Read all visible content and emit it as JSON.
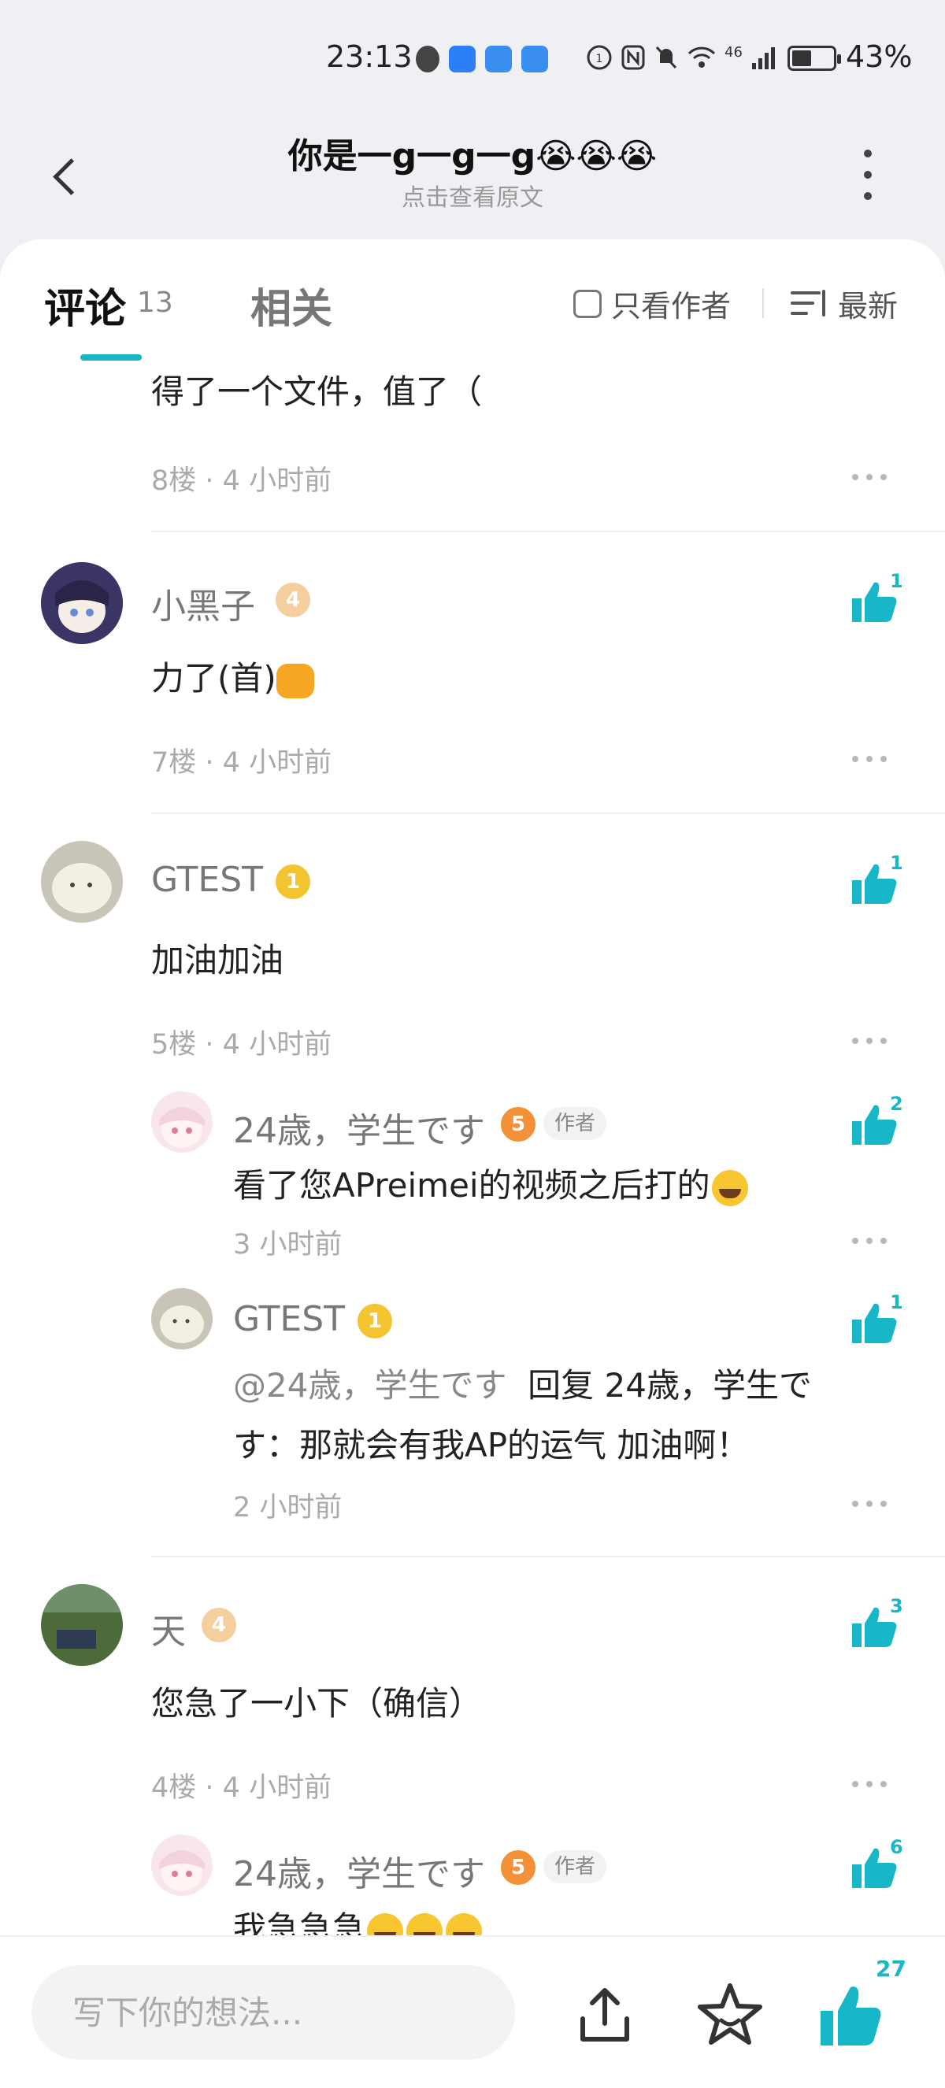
{
  "status_bar": {
    "time": "23:13",
    "net": "46",
    "battery": "43%"
  },
  "header": {
    "title": "你是一g一g一g😭😭😭",
    "subtitle": "点击查看原文"
  },
  "tabs": {
    "comments_label": "评论",
    "comments_count": "13",
    "related_label": "相关",
    "only_author": "只看作者",
    "sort": "最新"
  },
  "comments": [
    {
      "text": "得了一个文件，值了（",
      "floor": "8楼",
      "time": "4 小时前"
    },
    {
      "user": "小黑子",
      "level": "4",
      "text": "力了(首)",
      "floor": "7楼",
      "time": "4 小时前",
      "likes": "1"
    },
    {
      "user": "GTEST",
      "level": "1",
      "text": "加油加油",
      "floor": "5楼",
      "time": "4 小时前",
      "likes": "1",
      "replies": [
        {
          "user": "24歳，学生です",
          "level": "5",
          "tag": "作者",
          "text": "看了您APreimei的视频之后打的",
          "time": "3 小时前",
          "likes": "2"
        },
        {
          "user": "GTEST",
          "level": "1",
          "mention": "@24歳，学生です",
          "text_line1": "回复 24歳，学生で",
          "text_line2": "す：那就会有我AP的运气 加油啊！",
          "time": "2 小时前",
          "likes": "1"
        }
      ]
    },
    {
      "user": "天",
      "level": "4",
      "text": "您急了一小下（确信）",
      "floor": "4楼",
      "time": "4 小时前",
      "likes": "3",
      "replies": [
        {
          "user": "24歳，学生です",
          "level": "5",
          "tag": "作者",
          "text": "我急急急",
          "likes": "6"
        }
      ]
    }
  ],
  "bottom_bar": {
    "input_placeholder": "写下你的想法...",
    "like_total": "27"
  },
  "colors": {
    "accent": "#17b7c8",
    "like": "#17b7c8",
    "level_badge": "#f2b35b"
  },
  "icons": [
    "back-arrow-icon",
    "more-vertical-icon",
    "checkbox-icon",
    "sort-icon",
    "thumbs-up-icon",
    "more-horizontal-icon",
    "share-icon",
    "star-icon"
  ]
}
